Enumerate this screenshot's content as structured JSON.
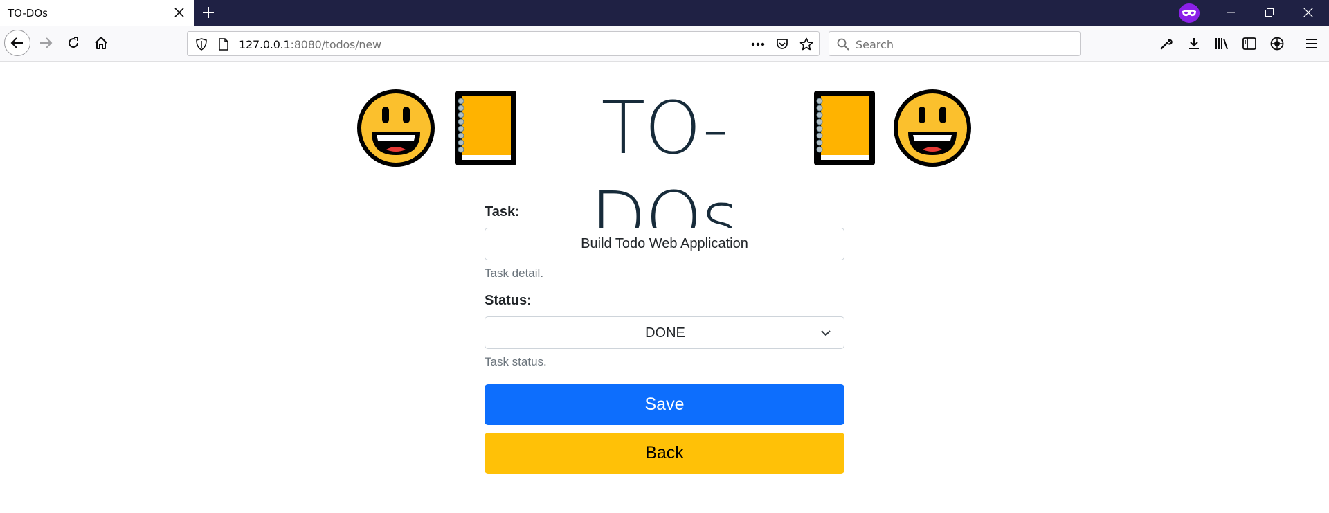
{
  "browser": {
    "tab_title": "TO-DOs",
    "url_host": "127.0.0.1",
    "url_rest": ":8080/todos/new",
    "search_placeholder": "Search"
  },
  "page": {
    "title": "TO-DOs",
    "header_emojis": [
      "grinning-face",
      "notebook",
      "notebook",
      "grinning-face"
    ]
  },
  "form": {
    "task_label": "Task:",
    "task_value": "Build Todo Web Application",
    "task_help": "Task detail.",
    "status_label": "Status:",
    "status_value": "DONE",
    "status_help": "Task status.",
    "save_label": "Save",
    "back_label": "Back"
  },
  "colors": {
    "titlebar": "#1f2144",
    "save_button": "#0d6efd",
    "back_button": "#ffc107",
    "private_badge": "#8b20e8"
  }
}
